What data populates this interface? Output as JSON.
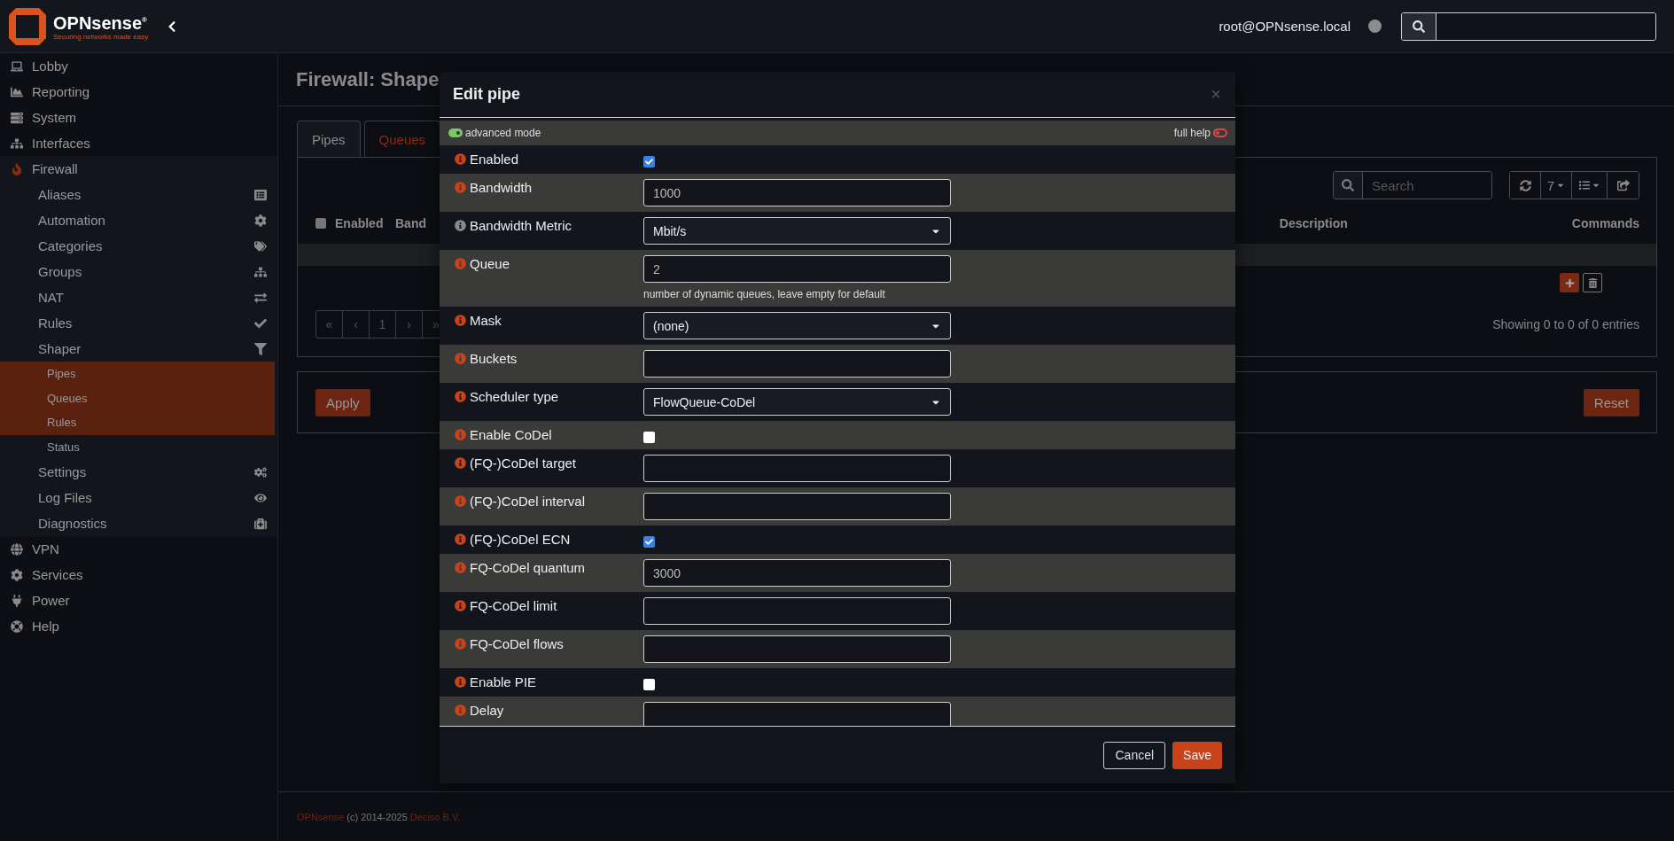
{
  "header": {
    "brand": "OPNsense$^{®}$",
    "tagline": "Securing networks made easy",
    "user": "root@OPNsense.local"
  },
  "sidebar": {
    "items": [
      {
        "label": "Lobby"
      },
      {
        "label": "Reporting"
      },
      {
        "label": "System"
      },
      {
        "label": "Interfaces"
      },
      {
        "label": "Firewall",
        "expanded": true,
        "children": [
          {
            "label": "Aliases"
          },
          {
            "label": "Automation"
          },
          {
            "label": "Categories"
          },
          {
            "label": "Groups"
          },
          {
            "label": "NAT"
          },
          {
            "label": "Rules"
          },
          {
            "label": "Shaper",
            "expanded": true,
            "children": [
              {
                "label": "Pipes",
                "selected": true
              },
              {
                "label": "Queues",
                "selected": true
              },
              {
                "label": "Rules",
                "selected": true
              },
              {
                "label": "Status",
                "selected": false
              }
            ]
          },
          {
            "label": "Settings"
          },
          {
            "label": "Log Files"
          },
          {
            "label": "Diagnostics"
          }
        ]
      },
      {
        "label": "VPN"
      },
      {
        "label": "Services"
      },
      {
        "label": "Power"
      },
      {
        "label": "Help"
      }
    ]
  },
  "page": {
    "title": "Firewall: Shape",
    "tabs": [
      {
        "label": "Pipes",
        "selected": false
      },
      {
        "label": "Queues",
        "selected": true
      }
    ],
    "table": {
      "search": {
        "placeholder": "Search"
      },
      "page_size": "7",
      "select_all": {
        "checked": false
      },
      "columns": [
        "Enabled",
        "Band",
        "Description",
        "Commands"
      ],
      "pagination": [
        "«",
        "‹",
        "1",
        "›",
        "»"
      ],
      "info": "Showing 0 to 0 of 0 entries"
    },
    "apply_button": "Apply",
    "reset_button": "Reset"
  },
  "modal": {
    "title": "Edit pipe",
    "close": "×",
    "advanced_mode": {
      "label": "advanced mode",
      "on": true
    },
    "full_help": {
      "label": "full help",
      "on": false
    },
    "fields": [
      {
        "kind": "checkbox",
        "label": "Enabled",
        "checked": true,
        "color": "#c8431a"
      },
      {
        "kind": "text",
        "label": "Bandwidth",
        "value": "1000",
        "color": "#c8431a"
      },
      {
        "kind": "select",
        "label": "Bandwidth Metric",
        "value": "Mbit/s",
        "color": "#8a8a8a"
      },
      {
        "kind": "text",
        "label": "Queue",
        "value": "2",
        "help": "number of dynamic queues, leave empty for default",
        "color": "#c8431a"
      },
      {
        "kind": "select",
        "label": "Mask",
        "value": "(none)",
        "color": "#c8431a"
      },
      {
        "kind": "text",
        "label": "Buckets",
        "color": "#c8431a"
      },
      {
        "kind": "select",
        "label": "Scheduler type",
        "value": "FlowQueue-CoDel",
        "color": "#c8431a"
      },
      {
        "kind": "checkbox",
        "label": "Enable CoDel",
        "checked": false,
        "color": "#c8431a"
      },
      {
        "kind": "text",
        "label": "(FQ-)CoDel target",
        "color": "#c8431a"
      },
      {
        "kind": "text",
        "label": "(FQ-)CoDel interval",
        "color": "#c8431a"
      },
      {
        "kind": "checkbox",
        "label": "(FQ-)CoDel ECN",
        "checked": true,
        "color": "#c8431a"
      },
      {
        "kind": "text",
        "label": "FQ-CoDel quantum",
        "value": "3000",
        "color": "#c8431a"
      },
      {
        "kind": "text",
        "label": "FQ-CoDel limit",
        "color": "#c8431a"
      },
      {
        "kind": "text",
        "label": "FQ-CoDel flows",
        "color": "#c8431a"
      },
      {
        "kind": "checkbox",
        "label": "Enable PIE",
        "checked": false,
        "color": "#c8431a"
      },
      {
        "kind": "text",
        "label": "Delay",
        "color": "#c8431a"
      }
    ],
    "buttons": {
      "cancel": "Cancel",
      "save": "Save"
    }
  },
  "footer": {
    "brand_link": "OPNsense",
    "text": "(c) 2014-2025",
    "company_link": "Deciso B.V."
  }
}
